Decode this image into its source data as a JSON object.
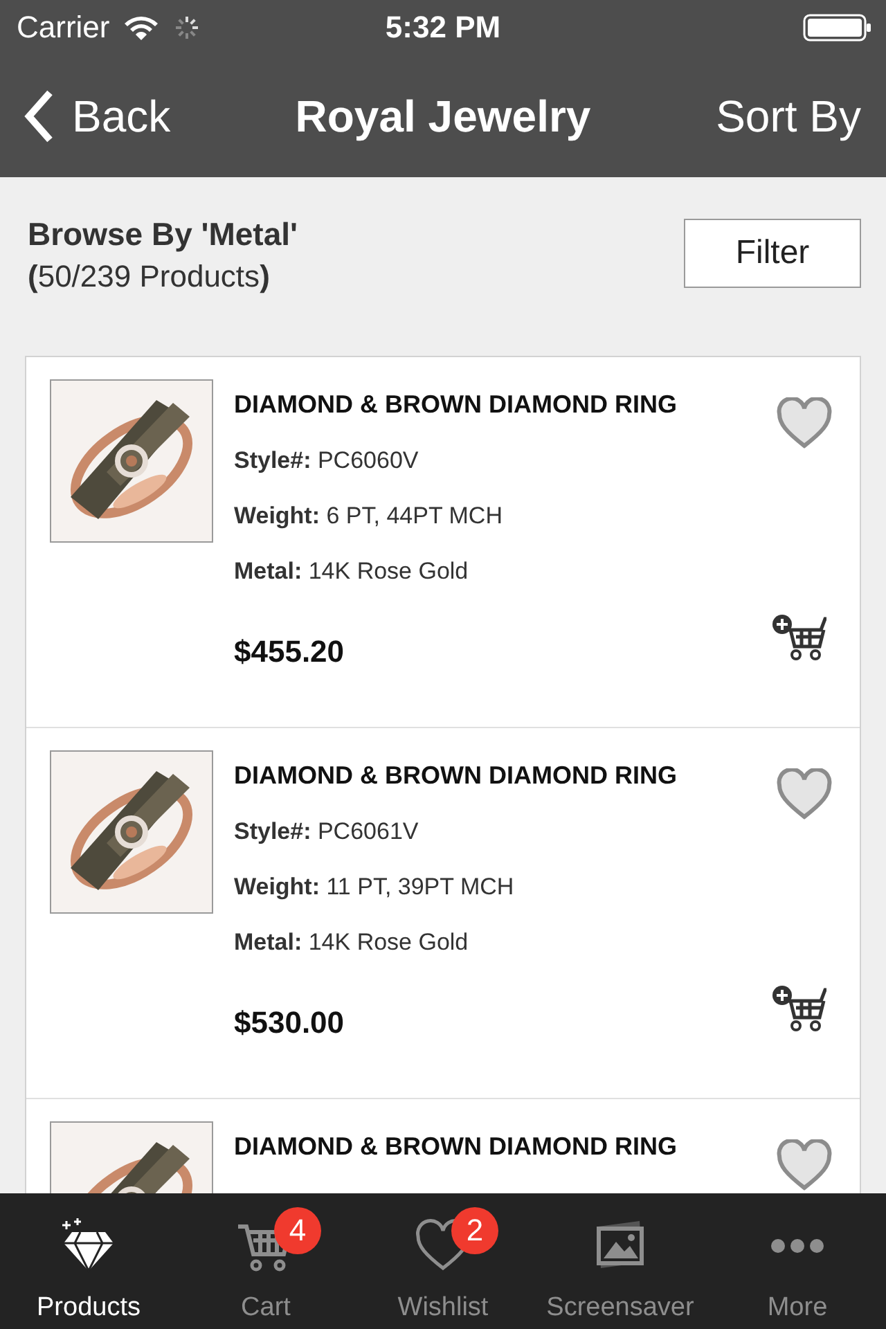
{
  "status_bar": {
    "carrier": "Carrier",
    "time": "5:32 PM"
  },
  "nav": {
    "back": "Back",
    "title": "Royal Jewelry",
    "action": "Sort By"
  },
  "browse": {
    "title": "Browse By 'Metal'",
    "count": "**(**50/239 Products**)**",
    "filter": "Filter"
  },
  "products": [
    {
      "title": "DIAMOND & BROWN DIAMOND RING",
      "details": [
        {
          "label": "Style#:",
          "value": "PC6060V"
        },
        {
          "label": "Weight:",
          "value": "6 PT, 44PT MCH"
        },
        {
          "label": "Metal:",
          "value": "14K Rose Gold"
        }
      ],
      "price": "$455.20"
    },
    {
      "title": "DIAMOND & BROWN DIAMOND RING",
      "details": [
        {
          "label": "Style#:",
          "value": "PC6061V"
        },
        {
          "label": "Weight:",
          "value": "11 PT, 39PT MCH"
        },
        {
          "label": "Metal:",
          "value": "14K Rose Gold"
        }
      ],
      "price": "$530.00"
    },
    {
      "title": "DIAMOND & BROWN DIAMOND RING"
    }
  ],
  "tabs": [
    {
      "kind": "diamond",
      "label": "Products",
      "selected": true
    },
    {
      "kind": "cart",
      "label": "Cart",
      "selected": false,
      "badge": "4"
    },
    {
      "kind": "heart",
      "label": "Wishlist",
      "selected": false,
      "badge": "2"
    },
    {
      "kind": "photos",
      "label": "Screensaver",
      "selected": false
    },
    {
      "kind": "more",
      "label": "More",
      "selected": false
    }
  ]
}
